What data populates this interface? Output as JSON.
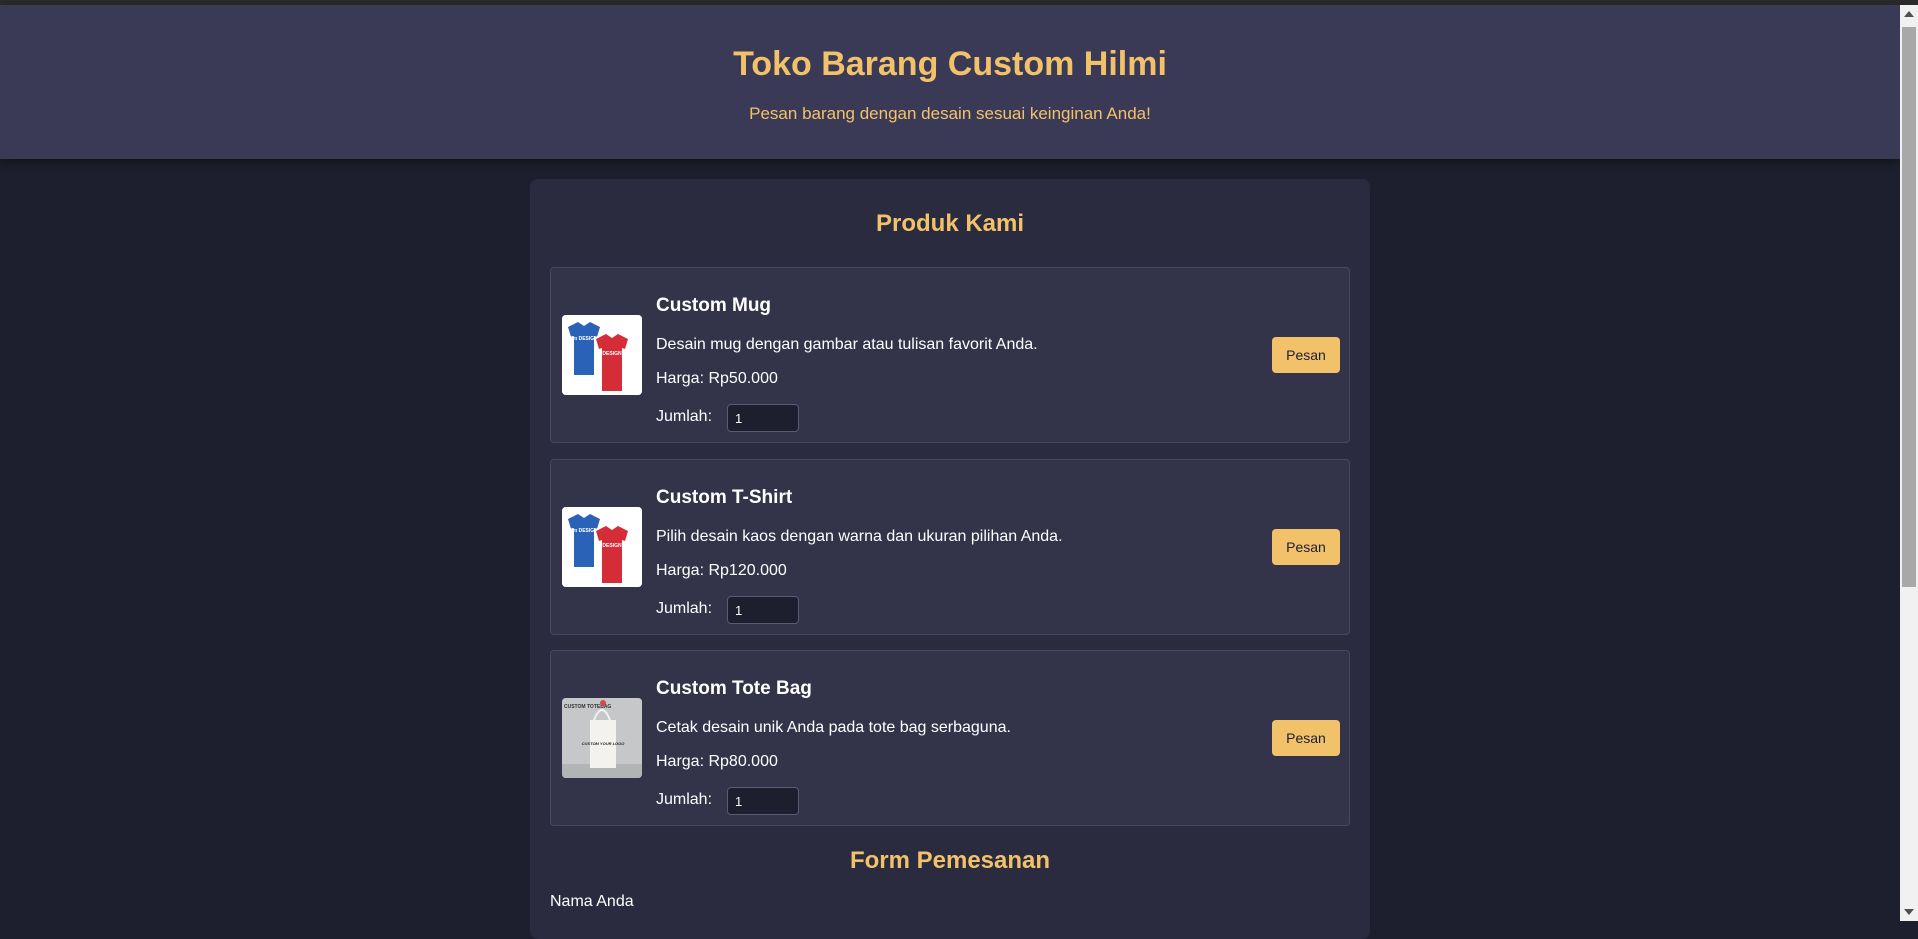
{
  "header": {
    "title": "Toko Barang Custom Hilmi",
    "subtitle": "Pesan barang dengan desain sesuai keinginan Anda!"
  },
  "products_section": {
    "title": "Produk Kami",
    "items": [
      {
        "name": "Custom Mug",
        "description": "Desain mug dengan gambar atau tulisan favorit Anda.",
        "price": "Harga: Rp50.000",
        "qty_label": "Jumlah:",
        "qty_value": "1",
        "button_label": "Pesan",
        "image_icon": "tshirt-image-icon"
      },
      {
        "name": "Custom T-Shirt",
        "description": "Pilih desain kaos dengan warna dan ukuran pilihan Anda.",
        "price": "Harga: Rp120.000",
        "qty_label": "Jumlah:",
        "qty_value": "1",
        "button_label": "Pesan",
        "image_icon": "tshirt-image-icon"
      },
      {
        "name": "Custom Tote Bag",
        "description": "Cetak desain unik Anda pada tote bag serbaguna.",
        "price": "Harga: Rp80.000",
        "qty_label": "Jumlah:",
        "qty_value": "1",
        "button_label": "Pesan",
        "image_icon": "tote-bag-image-icon"
      }
    ]
  },
  "order_form": {
    "title": "Form Pemesanan",
    "name_label": "Nama Anda"
  },
  "image_text": {
    "shirt_blue": "I'm DESIGN",
    "shirt_red": "DESIGN",
    "tote_corner": "CUSTOM TOTEBAG",
    "tote_logo": "CUSTOM YOUR LOGO"
  },
  "colors": {
    "accent": "#f2c26b",
    "background": "#1e1f2e",
    "header_bg": "#3a3a56",
    "card_bg": "#33344a"
  }
}
